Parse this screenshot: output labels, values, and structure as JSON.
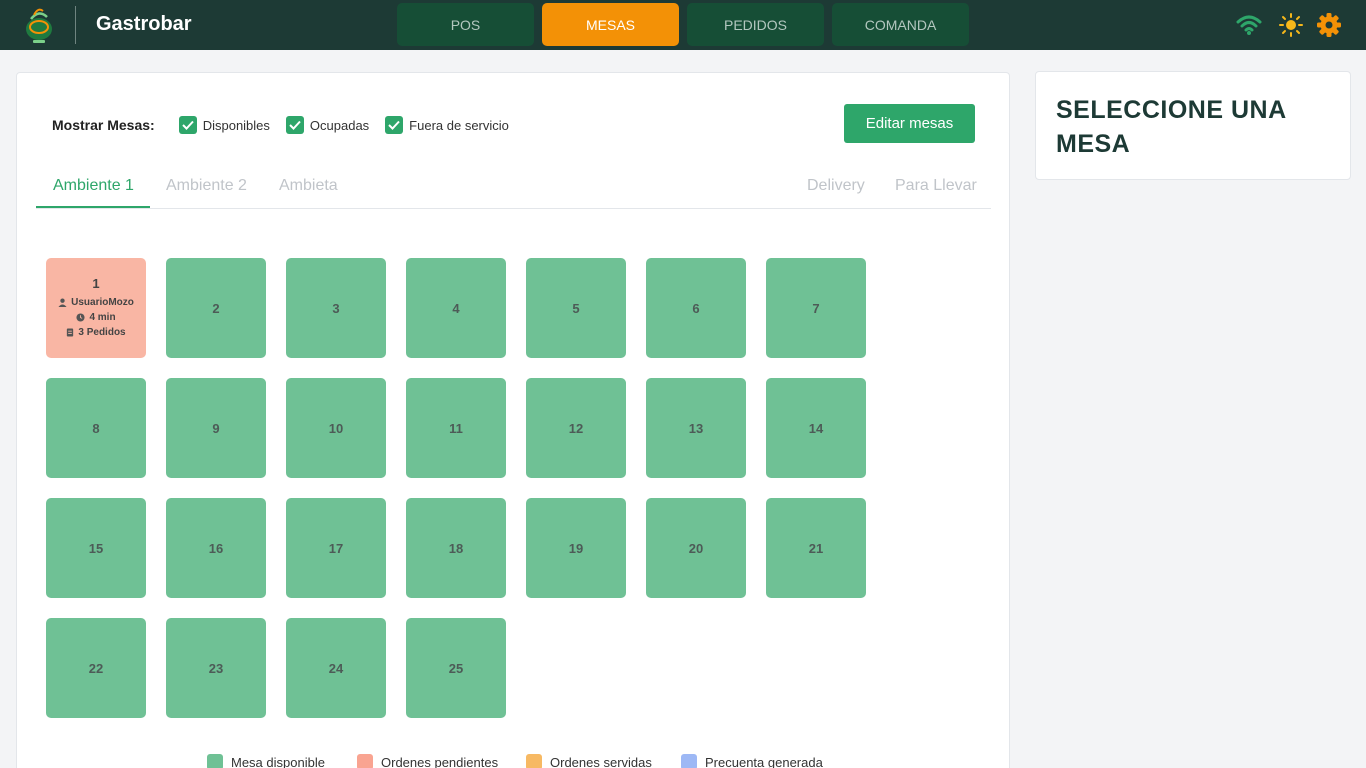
{
  "app": {
    "title": "Gastrobar"
  },
  "nav": [
    {
      "label": "POS",
      "active": false
    },
    {
      "label": "MESAS",
      "active": true
    },
    {
      "label": "PEDIDOS",
      "active": false
    },
    {
      "label": "COMANDA",
      "active": false
    }
  ],
  "topbar_icons": [
    "wifi-icon",
    "sun-icon",
    "gear-icon"
  ],
  "filters": {
    "label": "Mostrar Mesas:",
    "options": [
      {
        "label": "Disponibles",
        "checked": true
      },
      {
        "label": "Ocupadas",
        "checked": true
      },
      {
        "label": "Fuera de servicio",
        "checked": true
      }
    ],
    "edit_button": "Editar mesas"
  },
  "tabs": {
    "left": [
      "Ambiente 1",
      "Ambiente 2",
      "Ambieta"
    ],
    "right": [
      "Delivery",
      "Para Llevar"
    ],
    "active": "Ambiente 1"
  },
  "tables": [
    {
      "number": "1",
      "status": "pending",
      "waiter": "UsuarioMozo",
      "time": "4 min",
      "orders": "3 Pedidos"
    },
    {
      "number": "2",
      "status": "available"
    },
    {
      "number": "3",
      "status": "available"
    },
    {
      "number": "4",
      "status": "available"
    },
    {
      "number": "5",
      "status": "available"
    },
    {
      "number": "6",
      "status": "available"
    },
    {
      "number": "7",
      "status": "available"
    },
    {
      "number": "8",
      "status": "available"
    },
    {
      "number": "9",
      "status": "available"
    },
    {
      "number": "10",
      "status": "available"
    },
    {
      "number": "11",
      "status": "available"
    },
    {
      "number": "12",
      "status": "available"
    },
    {
      "number": "13",
      "status": "available"
    },
    {
      "number": "14",
      "status": "available"
    },
    {
      "number": "15",
      "status": "available"
    },
    {
      "number": "16",
      "status": "available"
    },
    {
      "number": "17",
      "status": "available"
    },
    {
      "number": "18",
      "status": "available"
    },
    {
      "number": "19",
      "status": "available"
    },
    {
      "number": "20",
      "status": "available"
    },
    {
      "number": "21",
      "status": "available"
    },
    {
      "number": "22",
      "status": "available"
    },
    {
      "number": "23",
      "status": "available"
    },
    {
      "number": "24",
      "status": "available"
    },
    {
      "number": "25",
      "status": "available"
    }
  ],
  "legend": [
    {
      "label": "Mesa disponible",
      "color": "#6fc195"
    },
    {
      "label": "Ordenes pendientes",
      "color": "#f9a491"
    },
    {
      "label": "Ordenes servidas",
      "color": "#f7b963"
    },
    {
      "label": "Precuenta generada",
      "color": "#9db8f5"
    }
  ],
  "side_panel": {
    "title": "SELECCIONE UNA MESA"
  },
  "colors": {
    "topbar": "#1d3a35",
    "accent_green": "#2ea66a",
    "accent_orange": "#f39106",
    "table_available": "#6fc195",
    "table_pending": "#f9b6a4"
  }
}
